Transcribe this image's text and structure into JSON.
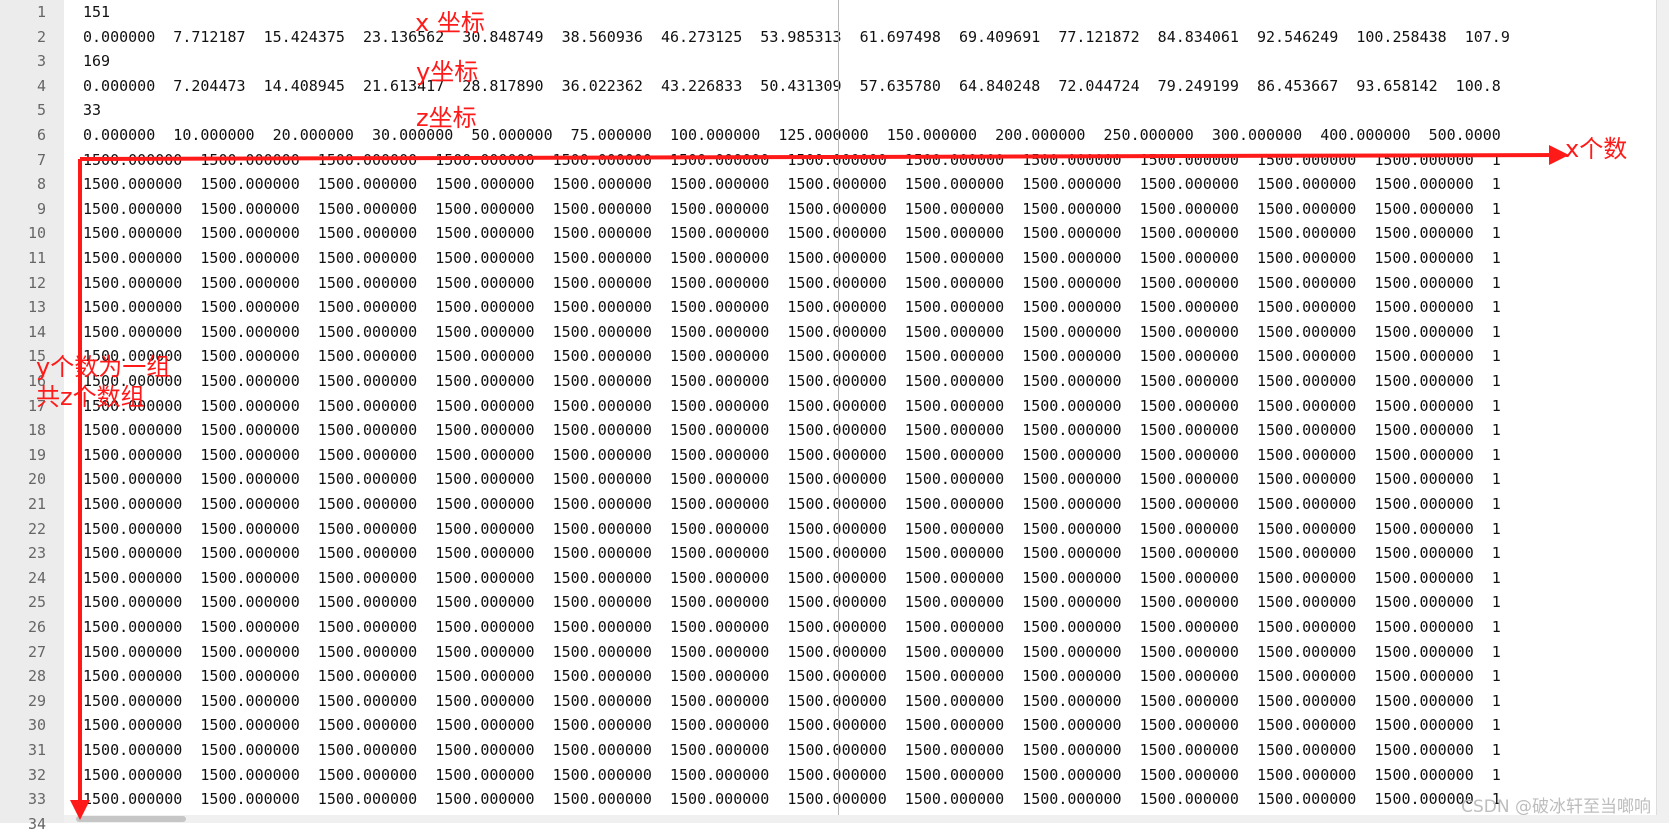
{
  "editor": {
    "line_numbers": [
      "1",
      "2",
      "3",
      "4",
      "5",
      "6",
      "7",
      "8",
      "9",
      "10",
      "11",
      "12",
      "13",
      "14",
      "15",
      "16",
      "17",
      "18",
      "19",
      "20",
      "21",
      "22",
      "23",
      "24",
      "25",
      "26",
      "27",
      "28",
      "29",
      "30",
      "31",
      "32",
      "33",
      "34"
    ],
    "lines": [
      "151",
      "0.000000  7.712187  15.424375  23.136562  30.848749  38.560936  46.273125  53.985313  61.697498  69.409691  77.121872  84.834061  92.546249  100.258438  107.9",
      "169",
      "0.000000  7.204473  14.408945  21.613417  28.817890  36.022362  43.226833  50.431309  57.635780  64.840248  72.044724  79.249199  86.453667  93.658142  100.8",
      "33",
      "0.000000  10.000000  20.000000  30.000000  50.000000  75.000000  100.000000  125.000000  150.000000  200.000000  250.000000  300.000000  400.000000  500.0000",
      "1500.000000  1500.000000  1500.000000  1500.000000  1500.000000  1500.000000  1500.000000  1500.000000  1500.000000  1500.000000  1500.000000  1500.000000  1",
      "1500.000000  1500.000000  1500.000000  1500.000000  1500.000000  1500.000000  1500.000000  1500.000000  1500.000000  1500.000000  1500.000000  1500.000000  1",
      "1500.000000  1500.000000  1500.000000  1500.000000  1500.000000  1500.000000  1500.000000  1500.000000  1500.000000  1500.000000  1500.000000  1500.000000  1",
      "1500.000000  1500.000000  1500.000000  1500.000000  1500.000000  1500.000000  1500.000000  1500.000000  1500.000000  1500.000000  1500.000000  1500.000000  1",
      "1500.000000  1500.000000  1500.000000  1500.000000  1500.000000  1500.000000  1500.000000  1500.000000  1500.000000  1500.000000  1500.000000  1500.000000  1",
      "1500.000000  1500.000000  1500.000000  1500.000000  1500.000000  1500.000000  1500.000000  1500.000000  1500.000000  1500.000000  1500.000000  1500.000000  1",
      "1500.000000  1500.000000  1500.000000  1500.000000  1500.000000  1500.000000  1500.000000  1500.000000  1500.000000  1500.000000  1500.000000  1500.000000  1",
      "1500.000000  1500.000000  1500.000000  1500.000000  1500.000000  1500.000000  1500.000000  1500.000000  1500.000000  1500.000000  1500.000000  1500.000000  1",
      "1500.000000  1500.000000  1500.000000  1500.000000  1500.000000  1500.000000  1500.000000  1500.000000  1500.000000  1500.000000  1500.000000  1500.000000  1",
      "1500.000000  1500.000000  1500.000000  1500.000000  1500.000000  1500.000000  1500.000000  1500.000000  1500.000000  1500.000000  1500.000000  1500.000000  1",
      "1500.000000  1500.000000  1500.000000  1500.000000  1500.000000  1500.000000  1500.000000  1500.000000  1500.000000  1500.000000  1500.000000  1500.000000  1",
      "1500.000000  1500.000000  1500.000000  1500.000000  1500.000000  1500.000000  1500.000000  1500.000000  1500.000000  1500.000000  1500.000000  1500.000000  1",
      "1500.000000  1500.000000  1500.000000  1500.000000  1500.000000  1500.000000  1500.000000  1500.000000  1500.000000  1500.000000  1500.000000  1500.000000  1",
      "1500.000000  1500.000000  1500.000000  1500.000000  1500.000000  1500.000000  1500.000000  1500.000000  1500.000000  1500.000000  1500.000000  1500.000000  1",
      "1500.000000  1500.000000  1500.000000  1500.000000  1500.000000  1500.000000  1500.000000  1500.000000  1500.000000  1500.000000  1500.000000  1500.000000  1",
      "1500.000000  1500.000000  1500.000000  1500.000000  1500.000000  1500.000000  1500.000000  1500.000000  1500.000000  1500.000000  1500.000000  1500.000000  1",
      "1500.000000  1500.000000  1500.000000  1500.000000  1500.000000  1500.000000  1500.000000  1500.000000  1500.000000  1500.000000  1500.000000  1500.000000  1",
      "1500.000000  1500.000000  1500.000000  1500.000000  1500.000000  1500.000000  1500.000000  1500.000000  1500.000000  1500.000000  1500.000000  1500.000000  1",
      "1500.000000  1500.000000  1500.000000  1500.000000  1500.000000  1500.000000  1500.000000  1500.000000  1500.000000  1500.000000  1500.000000  1500.000000  1",
      "1500.000000  1500.000000  1500.000000  1500.000000  1500.000000  1500.000000  1500.000000  1500.000000  1500.000000  1500.000000  1500.000000  1500.000000  1",
      "1500.000000  1500.000000  1500.000000  1500.000000  1500.000000  1500.000000  1500.000000  1500.000000  1500.000000  1500.000000  1500.000000  1500.000000  1",
      "1500.000000  1500.000000  1500.000000  1500.000000  1500.000000  1500.000000  1500.000000  1500.000000  1500.000000  1500.000000  1500.000000  1500.000000  1",
      "1500.000000  1500.000000  1500.000000  1500.000000  1500.000000  1500.000000  1500.000000  1500.000000  1500.000000  1500.000000  1500.000000  1500.000000  1",
      "1500.000000  1500.000000  1500.000000  1500.000000  1500.000000  1500.000000  1500.000000  1500.000000  1500.000000  1500.000000  1500.000000  1500.000000  1",
      "1500.000000  1500.000000  1500.000000  1500.000000  1500.000000  1500.000000  1500.000000  1500.000000  1500.000000  1500.000000  1500.000000  1500.000000  1",
      "1500.000000  1500.000000  1500.000000  1500.000000  1500.000000  1500.000000  1500.000000  1500.000000  1500.000000  1500.000000  1500.000000  1500.000000  1",
      "1500.000000  1500.000000  1500.000000  1500.000000  1500.000000  1500.000000  1500.000000  1500.000000  1500.000000  1500.000000  1500.000000  1500.000000  1"
    ]
  },
  "annotations": {
    "x_label": "x 坐标",
    "y_label": "y坐标",
    "z_label": "z坐标",
    "x_count": "x个数",
    "y_group_line1": "y个数为一组",
    "y_group_line2": "共z个数组",
    "color": "#ff1a1a"
  },
  "watermark": "CSDN @破冰轩至当啷响"
}
